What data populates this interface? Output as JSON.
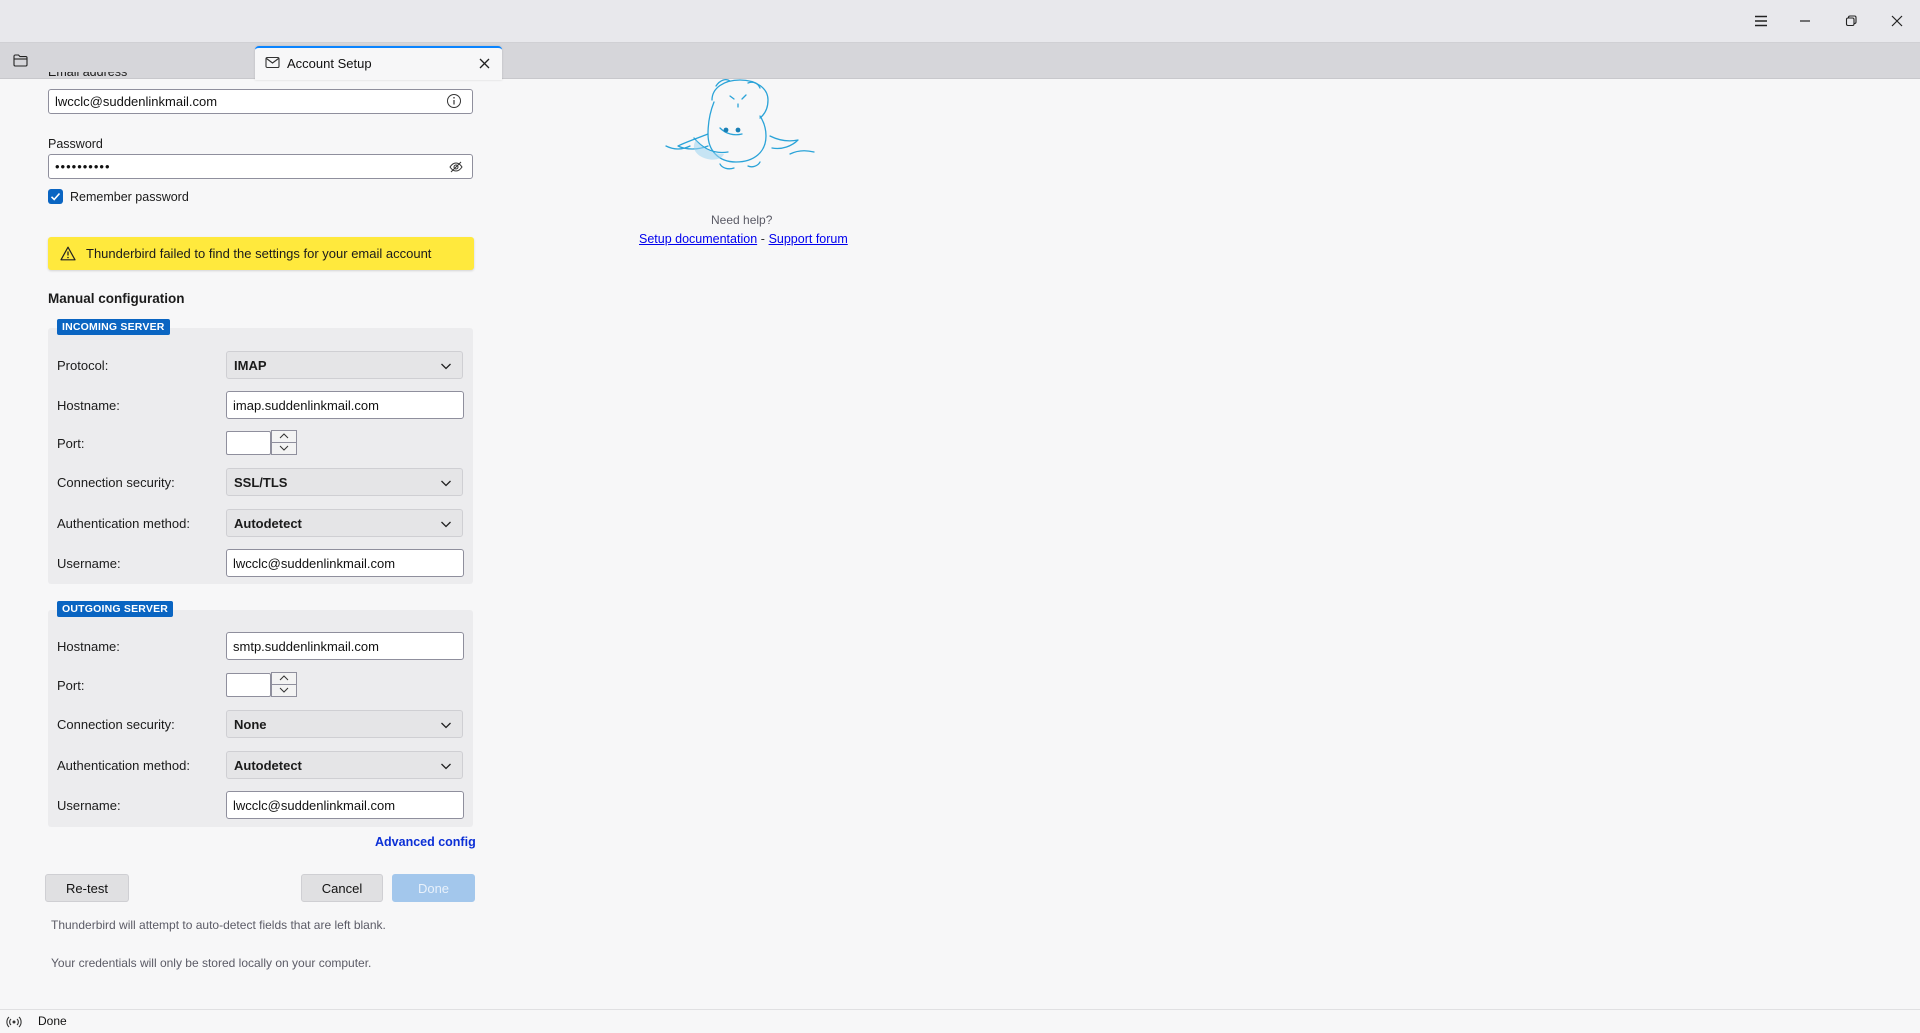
{
  "window": {
    "tab_title": "Account Setup",
    "menu_icon": "hamburger-icon",
    "minimize_icon": "minimize-icon",
    "maximize_icon": "restore-icon",
    "close_icon": "close-icon"
  },
  "form": {
    "email_label": "Email address",
    "email_value": "lwcclc@suddenlinkmail.com",
    "password_label": "Password",
    "password_value": "••••••••••",
    "remember_label": "Remember password",
    "remember_checked": true,
    "warning_text": "Thunderbird failed to find the settings for your email account",
    "manual_heading": "Manual configuration"
  },
  "incoming": {
    "legend": "INCOMING SERVER",
    "protocol_label": "Protocol:",
    "protocol_value": "IMAP",
    "hostname_label": "Hostname:",
    "hostname_value": "imap.suddenlinkmail.com",
    "port_label": "Port:",
    "port_value": "",
    "security_label": "Connection security:",
    "security_value": "SSL/TLS",
    "auth_label": "Authentication method:",
    "auth_value": "Autodetect",
    "username_label": "Username:",
    "username_value": "lwcclc@suddenlinkmail.com"
  },
  "outgoing": {
    "legend": "OUTGOING SERVER",
    "hostname_label": "Hostname:",
    "hostname_value": "smtp.suddenlinkmail.com",
    "port_label": "Port:",
    "port_value": "",
    "security_label": "Connection security:",
    "security_value": "None",
    "auth_label": "Authentication method:",
    "auth_value": "Autodetect",
    "username_label": "Username:",
    "username_value": "lwcclc@suddenlinkmail.com"
  },
  "actions": {
    "advanced_config": "Advanced config",
    "retest": "Re-test",
    "cancel": "Cancel",
    "done": "Done",
    "note1": "Thunderbird will attempt to auto-detect fields that are left blank.",
    "note2": "Your credentials will only be stored locally on your computer."
  },
  "help": {
    "need_help": "Need help?",
    "setup_docs": "Setup documentation",
    "separator": "-",
    "support_forum": "Support forum"
  },
  "status": {
    "text": "Done"
  },
  "colors": {
    "accent": "#0a84ff",
    "legend_bg": "#0a65c2",
    "warning_bg": "#ffe93d",
    "done_bg": "#a3c7ec"
  }
}
